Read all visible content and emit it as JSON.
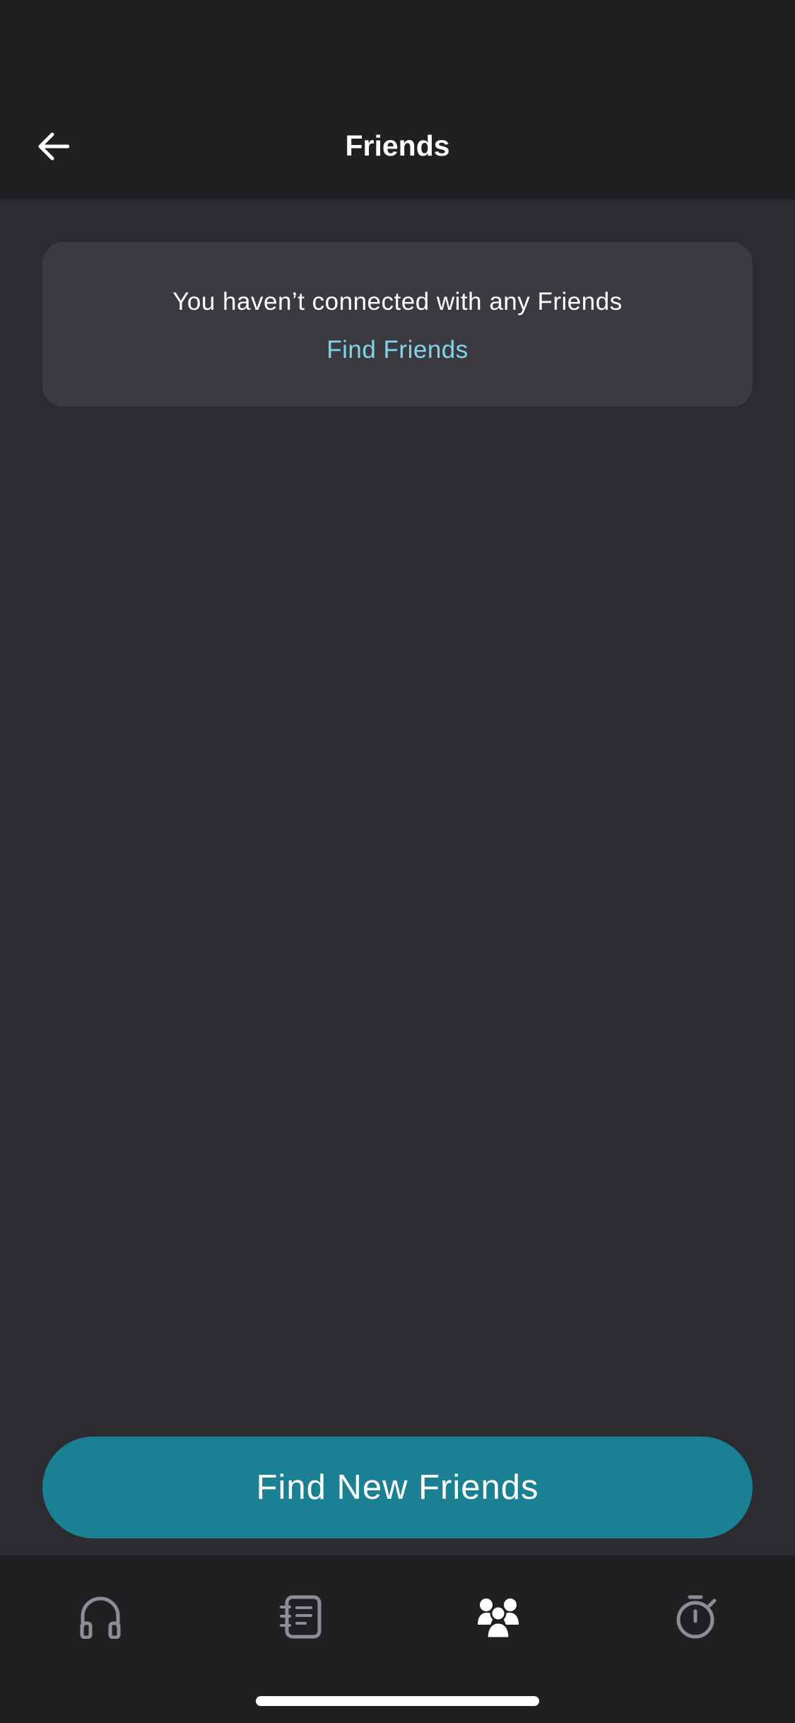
{
  "header": {
    "title": "Friends",
    "back_icon": "arrow-left-icon"
  },
  "empty_state": {
    "message": "You haven’t connected with any Friends",
    "link_label": "Find Friends"
  },
  "cta": {
    "label": "Find New Friends"
  },
  "tabbar": {
    "tabs": [
      {
        "icon": "headphones-icon",
        "active": false
      },
      {
        "icon": "journal-icon",
        "active": false
      },
      {
        "icon": "friends-icon",
        "active": true
      },
      {
        "icon": "stopwatch-icon",
        "active": false
      }
    ]
  },
  "colors": {
    "background": "#2c2b30",
    "header_bg": "#202022",
    "card_bg": "#3b3a40",
    "link": "#7fd6ea",
    "cta_bg": "#1a8094",
    "tab_inactive": "#8e8d92",
    "tab_active": "#ffffff"
  }
}
